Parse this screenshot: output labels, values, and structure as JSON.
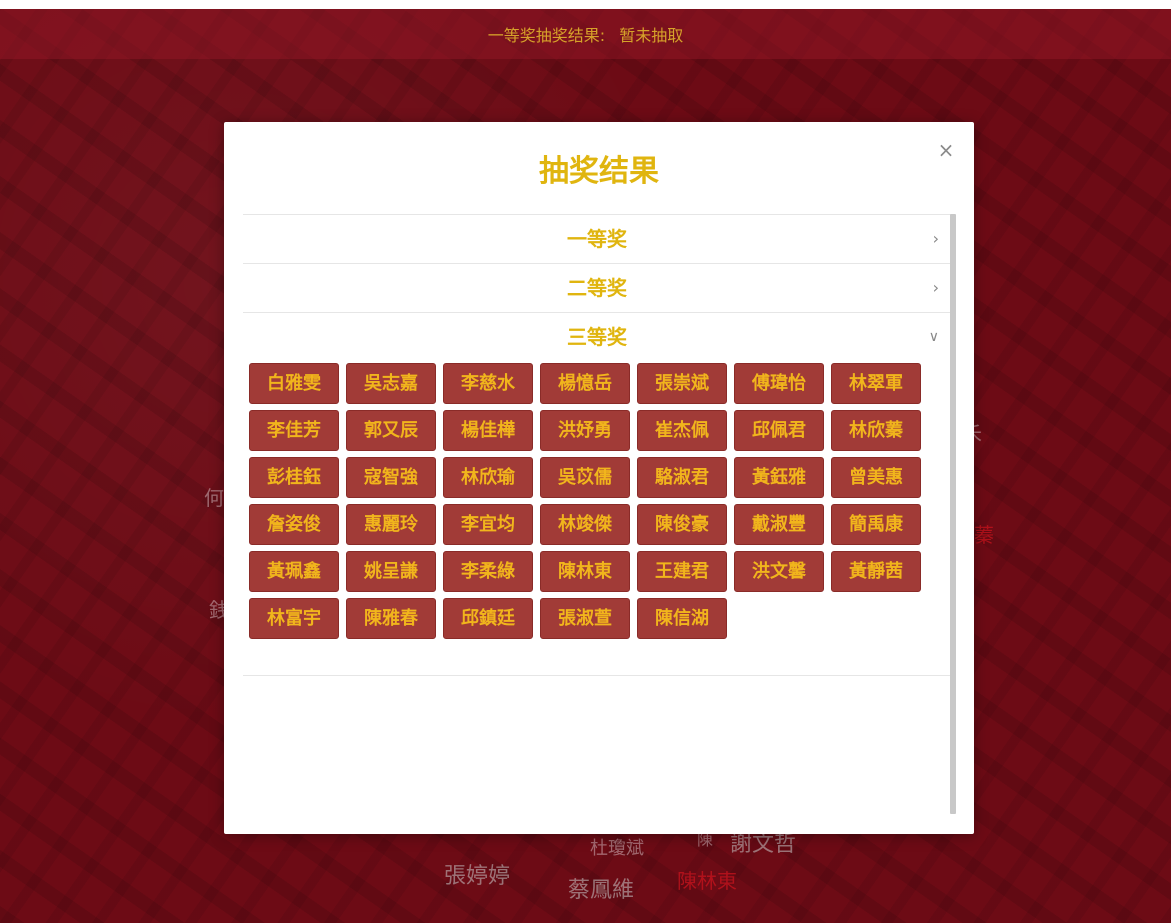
{
  "result_bar": {
    "label": "一等奖抽奖结果:",
    "value": "暂未抽取"
  },
  "background_names": [
    "何",
    "銭",
    "蓁",
    "杜瓊斌",
    "陳",
    "謝文哲",
    "張婷婷",
    "蔡鳳維",
    "陳林東",
    "禾"
  ],
  "modal": {
    "title": "抽奖结果",
    "close": "×",
    "sections": [
      {
        "title": "一等奖",
        "expanded": false,
        "icon": "chevron-right-icon",
        "winners": []
      },
      {
        "title": "二等奖",
        "expanded": false,
        "icon": "chevron-right-icon",
        "winners": []
      },
      {
        "title": "三等奖",
        "expanded": true,
        "icon": "chevron-down-icon",
        "winners": [
          "白雅雯",
          "吳志嘉",
          "李慈水",
          "楊憶岳",
          "張崇斌",
          "傅瑋怡",
          "林翠軍",
          "李佳芳",
          "郭又辰",
          "楊佳樺",
          "洪妤勇",
          "崔杰佩",
          "邱佩君",
          "林欣蓁",
          "彭桂鈺",
          "寇智強",
          "林欣瑜",
          "吳苡儒",
          "駱淑君",
          "黃鈺雅",
          "曾美惠",
          "詹姿俊",
          "惠麗玲",
          "李宜均",
          "林竣傑",
          "陳俊豪",
          "戴淑豐",
          "簡禹康",
          "黃珮鑫",
          "姚呈謙",
          "李柔綠",
          "陳林東",
          "王建君",
          "洪文馨",
          "黃靜茜",
          "林富宇",
          "陳雅春",
          "邱鎮廷",
          "張淑萱",
          "陳信湖"
        ]
      }
    ]
  },
  "colors": {
    "background": "#6d0b15",
    "accent_gold": "#e0b50f",
    "tag_bg": "#a13b37",
    "tag_text": "#f1b51c"
  }
}
